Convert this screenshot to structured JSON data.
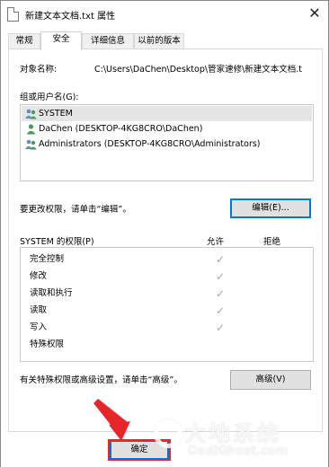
{
  "window": {
    "title": "新建文本文档.txt 属性",
    "close_glyph": "✕"
  },
  "tabs": [
    {
      "label": "常规",
      "active": false
    },
    {
      "label": "安全",
      "active": true
    },
    {
      "label": "详细信息",
      "active": false
    },
    {
      "label": "以前的版本",
      "active": false
    }
  ],
  "security": {
    "object_name_label": "对象名称:",
    "object_name_value": "C:\\Users\\DaChen\\Desktop\\管家速修\\新建文本文档.t",
    "groups_label": "组或用户名(G):",
    "users": [
      {
        "name": "SYSTEM",
        "icon": "user-group-icon",
        "selected": true
      },
      {
        "name": "DaChen (DESKTOP-4KG8CRO\\DaChen)",
        "icon": "user-icon",
        "selected": false
      },
      {
        "name": "Administrators (DESKTOP-4KG8CRO\\Administrators)",
        "icon": "user-group-icon",
        "selected": false
      }
    ],
    "change_hint": "要更改权限，请单击“编辑”。",
    "edit_button": "编辑(E)...",
    "permissions_header": "SYSTEM 的权限(P)",
    "allow_header": "允许",
    "deny_header": "拒绝",
    "permissions": [
      {
        "name": "完全控制",
        "allow": true,
        "deny": false
      },
      {
        "name": "修改",
        "allow": true,
        "deny": false
      },
      {
        "name": "读取和执行",
        "allow": true,
        "deny": false
      },
      {
        "name": "读取",
        "allow": true,
        "deny": false
      },
      {
        "name": "写入",
        "allow": true,
        "deny": false
      },
      {
        "name": "特殊权限",
        "allow": false,
        "deny": false
      }
    ],
    "check_glyph": "✓",
    "advanced_hint": "有关特殊权限或高级设置，请单击“高级”。",
    "advanced_button": "高级(V)"
  },
  "footer": {
    "ok_button": "确定"
  },
  "annotation": {
    "arrow_color": "#e8262a"
  },
  "watermark": {
    "main": "大地系统",
    "sub": "DadiGhost.com"
  },
  "colors": {
    "focus_blue": "#0078d7",
    "selected_row": "#e5e5e5",
    "button_face": "#e1e1e1"
  }
}
